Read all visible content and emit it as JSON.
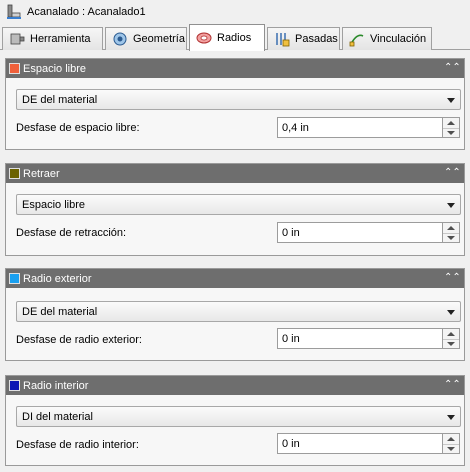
{
  "window": {
    "title": "Acanalado : Acanalado1"
  },
  "tabs": [
    {
      "label": "Herramienta",
      "icon": "tool-icon"
    },
    {
      "label": "Geometría",
      "icon": "geometry-icon"
    },
    {
      "label": "Radios",
      "icon": "radii-icon",
      "active": true
    },
    {
      "label": "Pasadas",
      "icon": "passes-icon"
    },
    {
      "label": "Vinculación",
      "icon": "linking-icon"
    }
  ],
  "panels": [
    {
      "title": "Espacio libre",
      "color": "#f0603a",
      "select": "DE del material",
      "field_label": "Desfase de espacio libre:",
      "value": "0,4 in"
    },
    {
      "title": "Retraer",
      "color": "#6b6200",
      "select": "Espacio libre",
      "field_label": "Desfase de retracción:",
      "value": "0 in"
    },
    {
      "title": "Radio exterior",
      "color": "#1aa0f0",
      "select": "DE del material",
      "field_label": "Desfase de radio exterior:",
      "value": "0 in"
    },
    {
      "title": "Radio interior",
      "color": "#0a14b4",
      "select": "DI del material",
      "field_label": "Desfase de radio interior:",
      "value": "0 in"
    }
  ],
  "colors": {
    "panel_header": "#6e6e6e",
    "background": "#f0f0f0"
  },
  "icons": {
    "window": "grooving-icon",
    "collapse": "double-chevron-up-icon",
    "dropdown": "chevron-down-icon"
  }
}
